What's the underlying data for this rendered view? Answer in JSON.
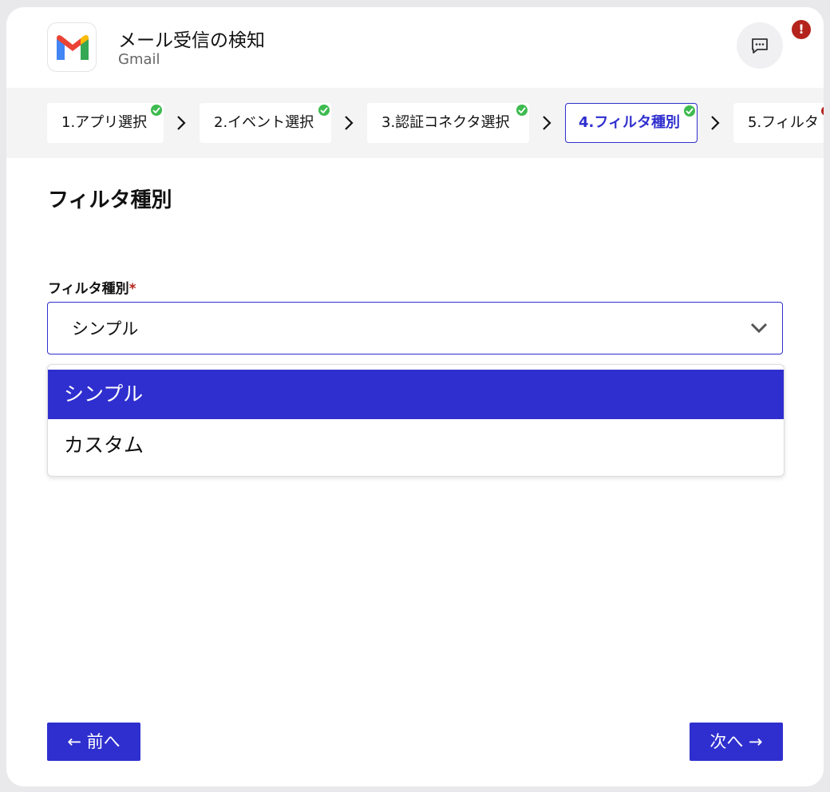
{
  "header": {
    "title": "メール受信の検知",
    "subtitle": "Gmail",
    "logo_icon": "gmail-logo-icon",
    "chat_icon": "chat-bubble-icon",
    "alert_badge": "!"
  },
  "stepper": {
    "steps": [
      {
        "label": "1.アプリ選択",
        "status": "complete"
      },
      {
        "label": "2.イベント選択",
        "status": "complete"
      },
      {
        "label": "3.認証コネクタ選択",
        "status": "complete"
      },
      {
        "label": "4.フィルタ種別",
        "status": "complete",
        "active": true
      },
      {
        "label": "5.フィルタ",
        "status": "error"
      }
    ],
    "separator_icon": "chevron-right-icon"
  },
  "main": {
    "title": "フィルタ種別",
    "field": {
      "label": "フィルタ種別",
      "required_mark": "*",
      "value": "シンプル",
      "options": [
        "シンプル",
        "カスタム"
      ],
      "selected_index": 0
    }
  },
  "footer": {
    "prev_label": "← 前へ",
    "next_label": "次へ →"
  },
  "colors": {
    "accent": "#2f2fcf",
    "success": "#3dbb4f",
    "error": "#b5231d"
  }
}
